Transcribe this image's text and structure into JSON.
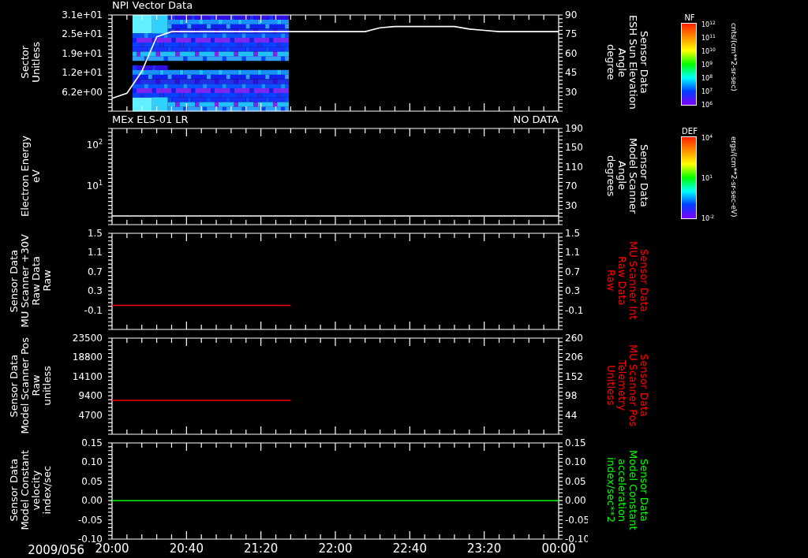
{
  "panels": [
    {
      "kind": "spectrogram",
      "header_left": "NPI Vector Data",
      "left_title": [
        "Sector",
        "Unitless"
      ],
      "left_axis": {
        "kind": "linear",
        "ticks": [
          "3.1e+01",
          "2.5e+01",
          "1.9e+01",
          "1.2e+01",
          "6.2e+00"
        ]
      },
      "right_title": {
        "lines": [
          "Sensor Data",
          "ESH Sun Elevation",
          "Angle",
          "degree"
        ],
        "color": "#ffffff"
      },
      "colorbar": {
        "label": "NF",
        "ticks": [
          "10$^{12}$",
          "10$^{11}$",
          "10$^{10}$",
          "10$^{9}$",
          "10$^{8}$",
          "10$^{7}$",
          "10$^{6}$"
        ],
        "units": "cnts/(cm**2-sr-sec)"
      },
      "chart_data": {
        "type": "line",
        "categories": [
          null,
          null,
          null,
          null,
          null,
          null,
          null,
          null,
          null,
          null,
          null,
          null,
          null,
          null,
          null,
          null,
          null,
          null,
          null,
          null,
          null,
          null,
          null,
          null,
          null,
          null,
          null,
          null,
          null,
          null,
          null
        ],
        "ylim": [
          15,
          90
        ],
        "yticks": [
          {
            "value": 90,
            "label": "90"
          },
          {
            "value": 75,
            "label": "75"
          },
          {
            "value": 60,
            "label": "60"
          },
          {
            "value": 45,
            "label": "45"
          },
          {
            "value": 30,
            "label": "30"
          }
        ],
        "series": [
          {
            "color": "#ffffff",
            "values": [
              25,
              29,
              46,
              73,
              77,
              77,
              77,
              77,
              77,
              77,
              77,
              77,
              77,
              77,
              77,
              77,
              77,
              77,
              80,
              81,
              81,
              81,
              81,
              81,
              79,
              78,
              77,
              77,
              77,
              77,
              77
            ]
          }
        ]
      }
    },
    {
      "kind": "line",
      "header_left": "MEx ELS-01 LR",
      "header_right": "NO DATA",
      "left_title": [
        "Electron Energy",
        "eV"
      ],
      "left_axis": {
        "kind": "log",
        "ticks": [
          "10$^{2}$",
          "10$^{1}$"
        ]
      },
      "right_title": {
        "lines": [
          "Sensor Data",
          "Model Scanner",
          "Angle",
          "degrees"
        ],
        "color": "#ffffff"
      },
      "colorbar": {
        "label": "DEF",
        "ticks": [
          "10$^{4}$",
          "10$^{1}$",
          "10$^{-2}$"
        ],
        "units": "ergs/(cm**2-sr-sec-eV)"
      },
      "chart_data": {
        "type": "line",
        "categories": [
          null,
          null,
          null,
          null,
          null,
          null,
          null,
          null,
          null,
          null,
          null,
          null,
          null,
          null,
          null,
          null,
          null,
          null,
          null,
          null,
          null,
          null,
          null,
          null,
          null,
          null,
          null,
          null,
          null,
          null,
          null
        ],
        "ylim": [
          -10,
          190
        ],
        "yticks": [
          {
            "value": 190,
            "label": "190"
          },
          {
            "value": 150,
            "label": "150"
          },
          {
            "value": 110,
            "label": "110"
          },
          {
            "value": 70,
            "label": "70"
          },
          {
            "value": 30,
            "label": "30"
          }
        ],
        "series": [
          {
            "color": "#ffffff",
            "values": [
              8,
              8,
              8,
              8,
              8,
              8,
              8,
              8,
              8,
              8,
              8,
              8,
              8,
              8,
              8,
              8,
              8,
              8,
              8,
              8,
              8,
              8,
              8,
              8,
              8,
              8,
              8,
              8,
              8,
              8,
              8
            ]
          }
        ]
      }
    },
    {
      "kind": "line",
      "left_title": [
        "Sensor Data",
        "MU Scanner +30V",
        "Raw Data",
        "Raw"
      ],
      "left_axis": {
        "kind": "linear",
        "ticks": [
          "1.5",
          "1.1",
          "0.7",
          "0.3",
          "-0.1"
        ]
      },
      "right_title": {
        "lines": [
          "Sensor Data",
          "MU Scanner Int",
          "Raw Data",
          "Raw"
        ],
        "color": "#ff0000"
      },
      "chart_data": {
        "type": "line",
        "categories": [
          null,
          null,
          null,
          null,
          null,
          null,
          null,
          null,
          null,
          null,
          null,
          null,
          null,
          null,
          null,
          null,
          null,
          null,
          null,
          null,
          null,
          null,
          null,
          null,
          null,
          null,
          null,
          null,
          null,
          null,
          null
        ],
        "ylim": [
          -0.5,
          1.5
        ],
        "yticks": [
          {
            "value": 1.5,
            "label": "1.5"
          },
          {
            "value": 1.1,
            "label": "1.1"
          },
          {
            "value": 0.7,
            "label": "0.7"
          },
          {
            "value": 0.3,
            "label": "0.3"
          },
          {
            "value": -0.1,
            "label": "-0.1"
          }
        ],
        "series": [
          {
            "color": "#ff0000",
            "values": [
              0,
              0,
              0,
              0,
              0,
              0,
              0,
              0,
              0,
              0,
              0,
              0,
              0,
              null,
              null,
              null,
              null,
              null,
              null,
              null,
              null,
              null,
              null,
              null,
              null,
              null,
              null,
              null,
              null,
              null,
              null
            ]
          }
        ]
      }
    },
    {
      "kind": "line",
      "left_title": [
        "Sensor Data",
        "Model Scanner Pos",
        "Raw",
        "unitless"
      ],
      "left_axis": {
        "kind": "linear",
        "ticks": [
          "23500",
          "18800",
          "14100",
          "9400",
          "4700"
        ]
      },
      "right_title": {
        "lines": [
          "Sensor Data",
          "MU Scanner Pos",
          "Telemetry",
          "Unitless"
        ],
        "color": "#ff0000"
      },
      "chart_data": {
        "type": "line",
        "categories": [
          null,
          null,
          null,
          null,
          null,
          null,
          null,
          null,
          null,
          null,
          null,
          null,
          null,
          null,
          null,
          null,
          null,
          null,
          null,
          null,
          null,
          null,
          null,
          null,
          null,
          null,
          null,
          null,
          null,
          null,
          null
        ],
        "ylim": [
          -10,
          260
        ],
        "yticks": [
          {
            "value": 260,
            "label": "260"
          },
          {
            "value": 206,
            "label": "206"
          },
          {
            "value": 152,
            "label": "152"
          },
          {
            "value": 98,
            "label": "98"
          },
          {
            "value": 44,
            "label": "44"
          }
        ],
        "series": [
          {
            "color": "#ff0000",
            "values": [
              85,
              85,
              85,
              85,
              85,
              85,
              85,
              85,
              85,
              85,
              85,
              85,
              85,
              null,
              null,
              null,
              null,
              null,
              null,
              null,
              null,
              null,
              null,
              null,
              null,
              null,
              null,
              null,
              null,
              null,
              null
            ]
          }
        ]
      }
    },
    {
      "kind": "line",
      "left_title": [
        "Sensor Data",
        "Model Constant",
        "velocity",
        "index/sec"
      ],
      "left_axis": {
        "kind": "linear",
        "ticks": [
          "0.15",
          "0.10",
          "0.05",
          "0.00",
          "-0.05",
          "-0.10"
        ]
      },
      "right_title": {
        "lines": [
          "Sensor Data",
          "Model Constant",
          "acceleration",
          "index/sec**2"
        ],
        "color": "#00ff00"
      },
      "date": "2009/056",
      "chart_data": {
        "type": "line",
        "x": [
          20,
          24
        ],
        "xlim": [
          20,
          24
        ],
        "ylim": [
          -0.1,
          0.15
        ],
        "xticks": [
          {
            "value": 20,
            "label": "20:00"
          },
          {
            "value": 20.6667,
            "label": "20:40"
          },
          {
            "value": 21.3333,
            "label": "21:20"
          },
          {
            "value": 22,
            "label": "22:00"
          },
          {
            "value": 22.6667,
            "label": "22:40"
          },
          {
            "value": 23.3333,
            "label": "23:20"
          },
          {
            "value": 24,
            "label": "00:00"
          }
        ],
        "yticks": [
          {
            "value": 0.15,
            "label": "0.15"
          },
          {
            "value": 0.1,
            "label": "0.10"
          },
          {
            "value": 0.05,
            "label": "0.05"
          },
          {
            "value": 0,
            "label": "0.00"
          },
          {
            "value": -0.05,
            "label": "-0.05"
          },
          {
            "value": -0.1,
            "label": "-0.10"
          }
        ],
        "series": [
          {
            "color": "#00ff00",
            "values": [
              0,
              0
            ]
          }
        ]
      }
    }
  ]
}
